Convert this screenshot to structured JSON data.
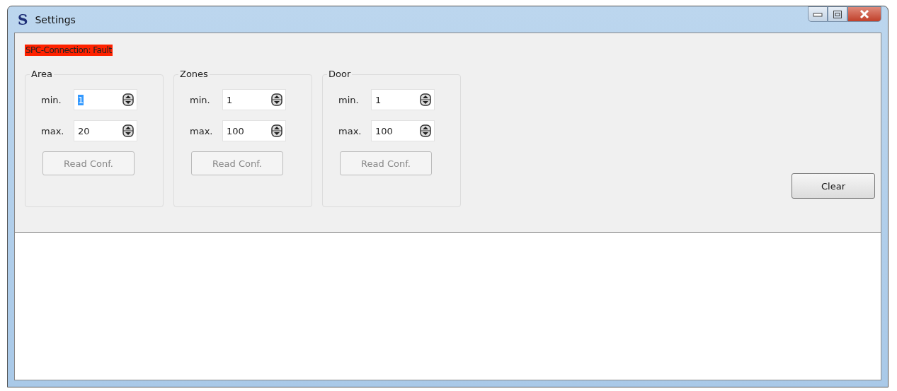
{
  "window": {
    "title": "Settings",
    "app_letter": "S"
  },
  "connection_status": {
    "text": "SPC-Connection: Fault",
    "kind": "fault"
  },
  "groups": [
    {
      "title": "Area",
      "fields": [
        {
          "label": "min.",
          "value": "1",
          "selected": true
        },
        {
          "label": "max.",
          "value": "20",
          "selected": false
        }
      ],
      "button": {
        "label": "Read Conf.",
        "disabled": true
      }
    },
    {
      "title": "Zones",
      "fields": [
        {
          "label": "min.",
          "value": "1",
          "selected": false
        },
        {
          "label": "max.",
          "value": "100",
          "selected": false
        }
      ],
      "button": {
        "label": "Read Conf.",
        "disabled": true
      }
    },
    {
      "title": "Door",
      "fields": [
        {
          "label": "min.",
          "value": "1",
          "selected": false
        },
        {
          "label": "max.",
          "value": "100",
          "selected": false
        }
      ],
      "button": {
        "label": "Read Conf.",
        "disabled": true
      }
    }
  ],
  "clear_button": {
    "label": "Clear",
    "disabled": false
  }
}
